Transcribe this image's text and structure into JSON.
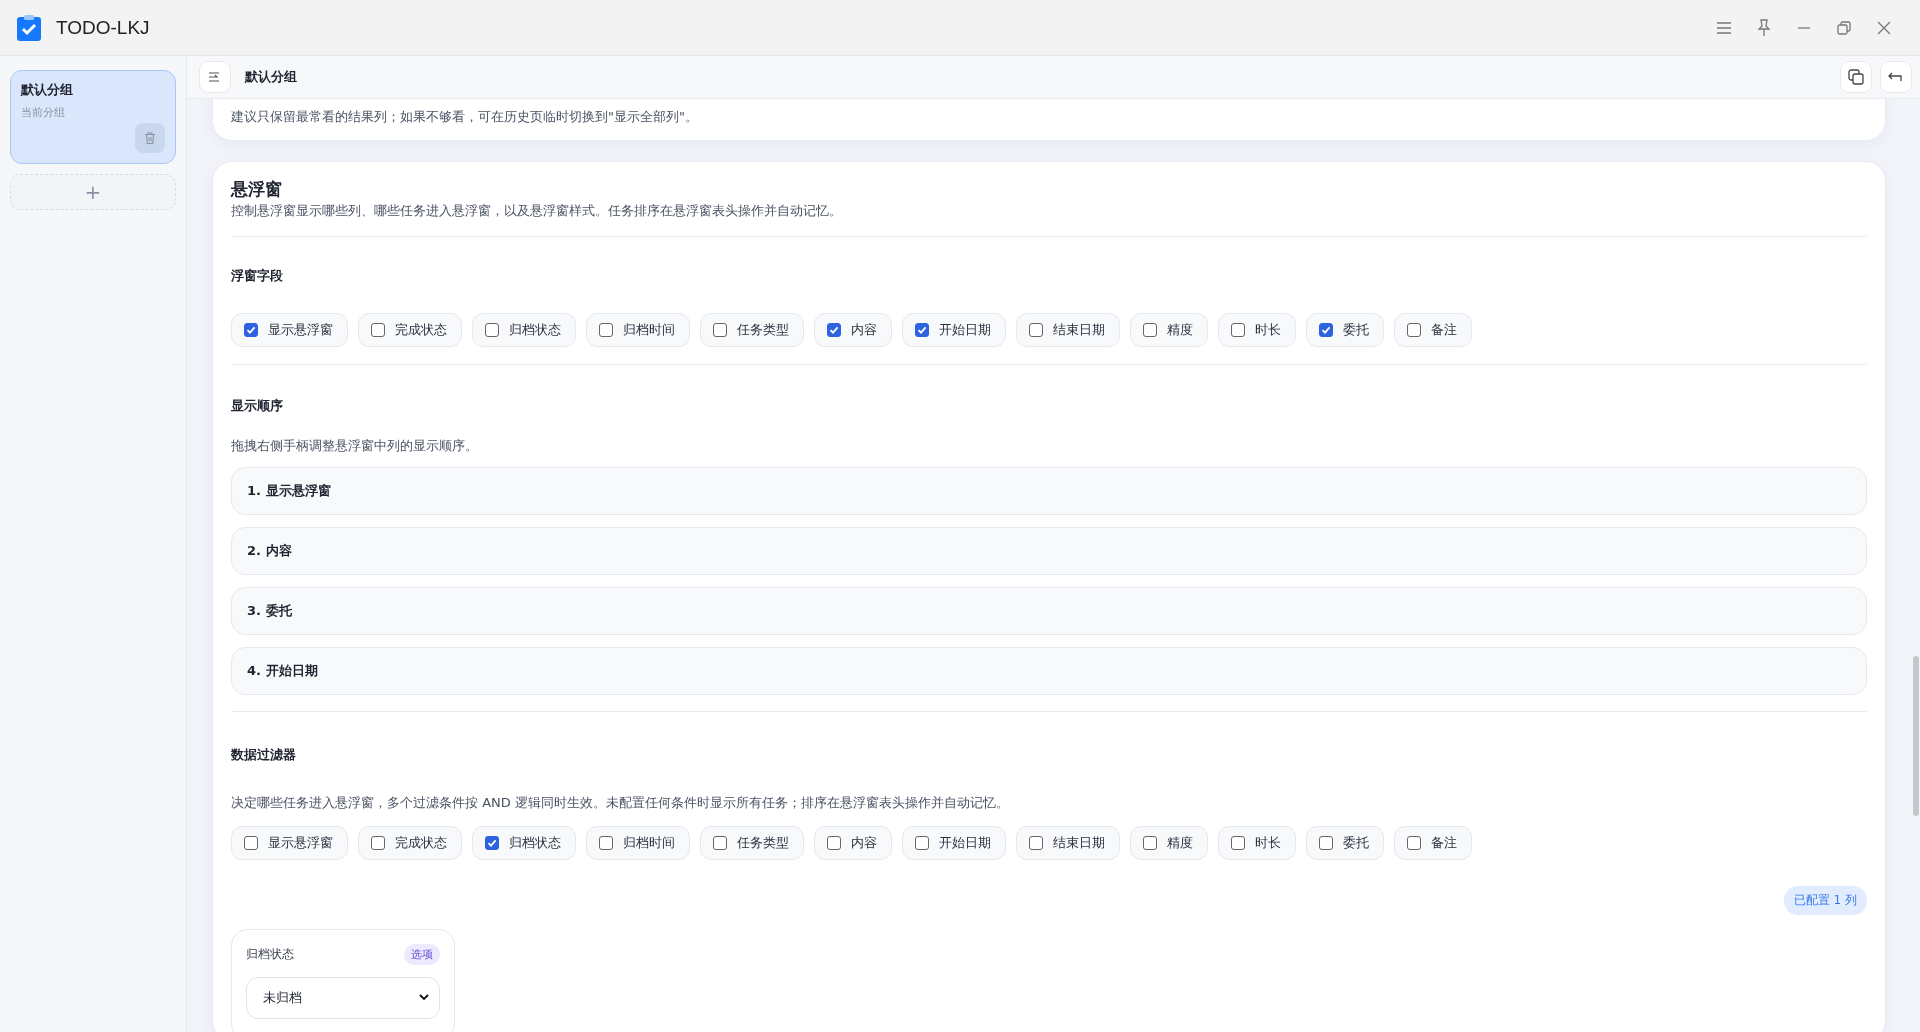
{
  "window": {
    "title": "TODO-LKJ"
  },
  "sidebar": {
    "groups": [
      {
        "name": "默认分组",
        "subtitle": "当前分组",
        "selected": true
      }
    ],
    "add_label": "+"
  },
  "header": {
    "title": "默认分组"
  },
  "previous_card": {
    "note": "建议只保留最常看的结果列；如果不够看，可在历史页临时切换到\"显示全部列\"。"
  },
  "floating_window": {
    "title": "悬浮窗",
    "description": "控制悬浮窗显示哪些列、哪些任务进入悬浮窗，以及悬浮窗样式。任务排序在悬浮窗表头操作并自动记忆。",
    "fields": {
      "title": "浮窗字段",
      "options": [
        {
          "label": "显示悬浮窗",
          "checked": true
        },
        {
          "label": "完成状态",
          "checked": false
        },
        {
          "label": "归档状态",
          "checked": false
        },
        {
          "label": "归档时间",
          "checked": false
        },
        {
          "label": "任务类型",
          "checked": false
        },
        {
          "label": "内容",
          "checked": true
        },
        {
          "label": "开始日期",
          "checked": true
        },
        {
          "label": "结束日期",
          "checked": false
        },
        {
          "label": "精度",
          "checked": false
        },
        {
          "label": "时长",
          "checked": false
        },
        {
          "label": "委托",
          "checked": true
        },
        {
          "label": "备注",
          "checked": false
        }
      ]
    },
    "order": {
      "title": "显示顺序",
      "description": "拖拽右侧手柄调整悬浮窗中列的显示顺序。",
      "items": [
        "1. 显示悬浮窗",
        "2. 内容",
        "3. 委托",
        "4. 开始日期"
      ]
    },
    "filter": {
      "title": "数据过滤器",
      "description": "决定哪些任务进入悬浮窗，多个过滤条件按 AND 逻辑同时生效。未配置任何条件时显示所有任务；排序在悬浮窗表头操作并自动记忆。",
      "options": [
        {
          "label": "显示悬浮窗",
          "checked": false
        },
        {
          "label": "完成状态",
          "checked": false
        },
        {
          "label": "归档状态",
          "checked": true
        },
        {
          "label": "归档时间",
          "checked": false
        },
        {
          "label": "任务类型",
          "checked": false
        },
        {
          "label": "内容",
          "checked": false
        },
        {
          "label": "开始日期",
          "checked": false
        },
        {
          "label": "结束日期",
          "checked": false
        },
        {
          "label": "精度",
          "checked": false
        },
        {
          "label": "时长",
          "checked": false
        },
        {
          "label": "委托",
          "checked": false
        },
        {
          "label": "备注",
          "checked": false
        }
      ],
      "count_badge": "已配置 1 列",
      "conditions": [
        {
          "name": "归档状态",
          "tag": "选项",
          "value": "未归档"
        }
      ]
    }
  }
}
